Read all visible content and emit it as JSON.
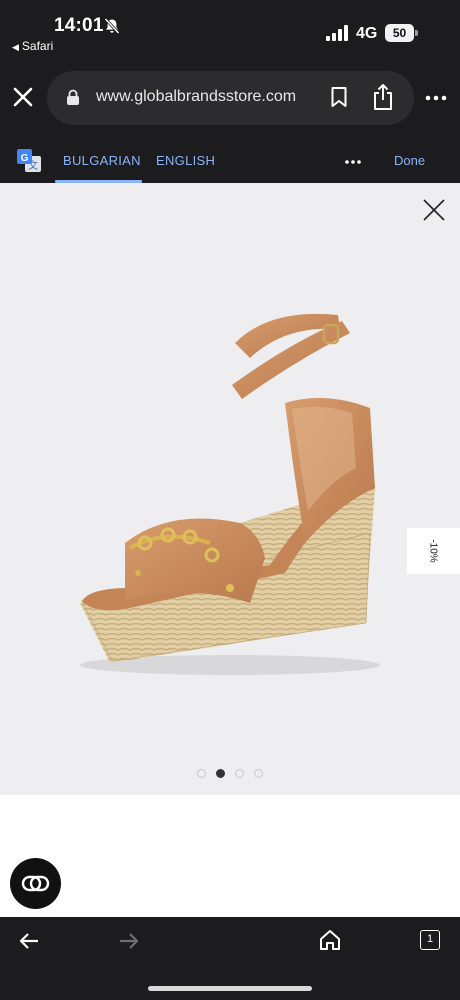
{
  "status_bar": {
    "time": "14:01",
    "back_app": "Safari",
    "network": "4G",
    "battery": "50"
  },
  "browser": {
    "url": "www.globalbrandsstore.com"
  },
  "translate_bar": {
    "languages": [
      "BULGARIAN",
      "ENGLISH"
    ],
    "selected": "BULGARIAN",
    "done_label": "Done"
  },
  "product": {
    "discount_badge": "-10%",
    "gallery_page": 2,
    "gallery_total": 4
  },
  "tabs_count": "1",
  "icons": {
    "bell": "bell-slash-icon",
    "close": "close-icon",
    "lock": "lock-icon",
    "bookmark": "bookmark-icon",
    "share": "share-icon",
    "more": "more-icon",
    "translate": "google-translate-icon",
    "chat": "chat-icon",
    "back": "arrow-left-icon",
    "forward": "arrow-right-icon",
    "home": "home-icon",
    "tabs": "tabs-icon"
  },
  "colors": {
    "chrome_bg": "#1c1c1e",
    "accent_blue": "#8ab4f8",
    "product_bg": "#eeeef0",
    "shoe_leather": "#c98d5f"
  }
}
